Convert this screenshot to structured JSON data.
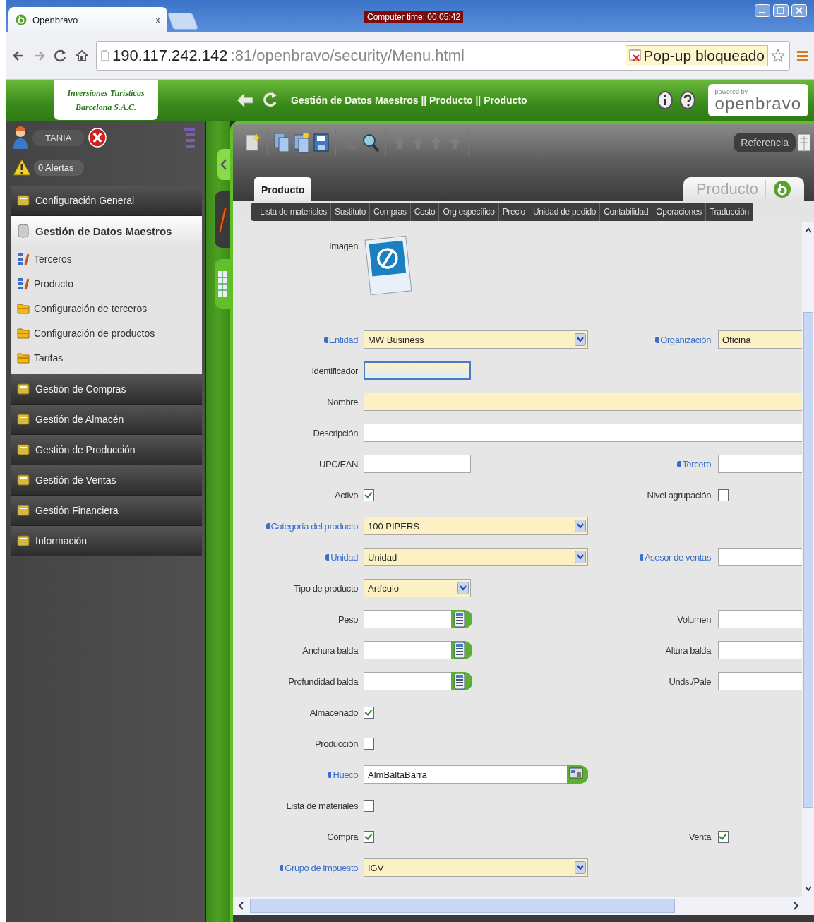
{
  "browser": {
    "tab_title": "Openbravo",
    "tab_close": "x",
    "clock": "Computer time: 00:05:42",
    "url_host": "190.117.242.142",
    "url_path": ":81/openbravo/security/Menu.html",
    "popup_notice": "Pop-up bloqueado"
  },
  "header": {
    "company_line1": "Inversiones Turísticas",
    "company_line2": "Barcelona S.A.C.",
    "breadcrumb": "Gestión de Datos Maestros || Producto || Producto",
    "powered_by": "powered by",
    "brand": "openbravo"
  },
  "sidebar": {
    "user": "TANIA",
    "alerts": "0 Alertas",
    "menu": [
      {
        "label": "Configuración General",
        "expanded": false
      },
      {
        "label": "Gestión de Datos Maestros",
        "expanded": true,
        "children": [
          {
            "label": "Terceros",
            "kind": "window"
          },
          {
            "label": "Producto",
            "kind": "window"
          },
          {
            "label": "Configuración de terceros",
            "kind": "folder"
          },
          {
            "label": "Configuración de productos",
            "kind": "folder"
          },
          {
            "label": "Tarifas",
            "kind": "folder"
          }
        ]
      },
      {
        "label": "Gestión de Compras",
        "expanded": false
      },
      {
        "label": "Gestión de Almacén",
        "expanded": false
      },
      {
        "label": "Gestión de Producción",
        "expanded": false
      },
      {
        "label": "Gestión de Ventas",
        "expanded": false
      },
      {
        "label": "Gestión Financiera",
        "expanded": false
      },
      {
        "label": "Información",
        "expanded": false
      }
    ]
  },
  "toolbar": {
    "reference": "Referencia"
  },
  "tabs": [
    {
      "label": "Producto",
      "selected": true
    }
  ],
  "window_title": "Producto",
  "subtabs": [
    "Lista de materiales",
    "Sustituto",
    "Compras",
    "Costo",
    "Org específico",
    "Precio",
    "Unidad de pedido",
    "Contabilidad",
    "Operaciones",
    "Traducción"
  ],
  "form": {
    "rows": [
      {
        "left": {
          "label": "Imagen",
          "required": false,
          "kind": "image"
        }
      },
      {
        "left": {
          "label": "Entidad",
          "required": true,
          "kind": "select",
          "value": "MW Business"
        },
        "right": {
          "label": "Organización",
          "required": true,
          "kind": "select",
          "value": "Oficina"
        }
      },
      {
        "left": {
          "label": "Identificador",
          "required": false,
          "kind": "text",
          "focused": true
        }
      },
      {
        "left": {
          "label": "Nombre",
          "required": false,
          "kind": "wide-text",
          "mandatory": true
        }
      },
      {
        "left": {
          "label": "Descripción",
          "required": false,
          "kind": "wide-text",
          "mandatory": false
        }
      },
      {
        "left": {
          "label": "UPC/EAN",
          "required": false,
          "kind": "text",
          "focused": false
        },
        "right": {
          "label": "Tercero",
          "required": true,
          "kind": "text"
        }
      },
      {
        "left": {
          "label": "Activo",
          "required": false,
          "kind": "checkbox",
          "checked": true
        },
        "right": {
          "label": "Nivel agrupación",
          "required": false,
          "kind": "checkbox",
          "checked": false
        }
      },
      {
        "left": {
          "label": "Categoría del producto",
          "required": true,
          "kind": "select",
          "value": "100 PIPERS"
        }
      },
      {
        "left": {
          "label": "Unidad",
          "required": true,
          "kind": "select",
          "value": "Unidad"
        },
        "right": {
          "label": "Asesor de ventas",
          "required": true,
          "kind": "text"
        }
      },
      {
        "left": {
          "label": "Tipo de producto",
          "required": false,
          "kind": "short-select",
          "value": "Artículo"
        }
      },
      {
        "left": {
          "label": "Peso",
          "required": false,
          "kind": "number"
        },
        "right": {
          "label": "Volumen",
          "required": false,
          "kind": "text"
        }
      },
      {
        "left": {
          "label": "Anchura balda",
          "required": false,
          "kind": "number"
        },
        "right": {
          "label": "Altura balda",
          "required": false,
          "kind": "text"
        }
      },
      {
        "left": {
          "label": "Profundidad balda",
          "required": false,
          "kind": "number"
        },
        "right": {
          "label": "Unds./Pale",
          "required": false,
          "kind": "text"
        }
      },
      {
        "left": {
          "label": "Almacenado",
          "required": false,
          "kind": "checkbox",
          "checked": true
        }
      },
      {
        "left": {
          "label": "Producción",
          "required": false,
          "kind": "checkbox",
          "checked": false
        }
      },
      {
        "left": {
          "label": "Hueco",
          "required": true,
          "kind": "locator",
          "value": "AlmBaltaBarra"
        }
      },
      {
        "left": {
          "label": "Lista de materiales",
          "required": false,
          "kind": "checkbox",
          "checked": false
        }
      },
      {
        "left": {
          "label": "Compra",
          "required": false,
          "kind": "checkbox",
          "checked": true
        },
        "right": {
          "label": "Venta",
          "required": false,
          "kind": "checkbox",
          "checked": true
        }
      },
      {
        "left": {
          "label": "Grupo de impuesto",
          "required": true,
          "kind": "select",
          "value": "IGV"
        }
      }
    ]
  }
}
